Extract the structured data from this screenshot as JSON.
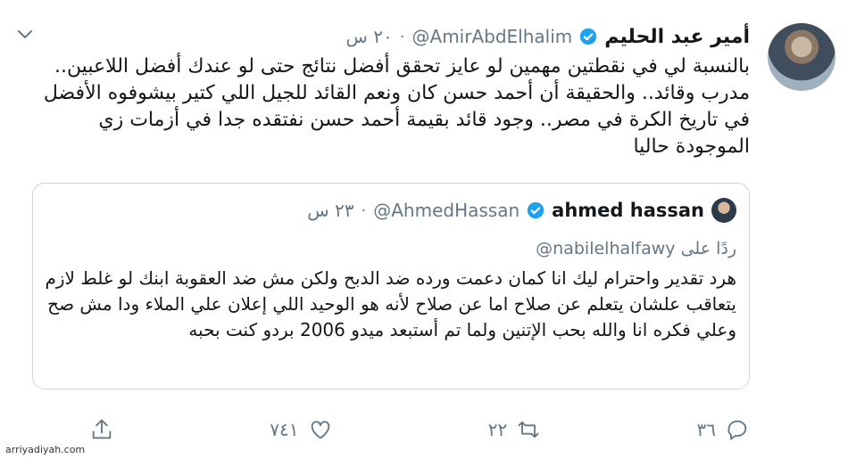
{
  "tweet": {
    "display_name": "أمير عبد الحليم",
    "handle": "@AmirAbdElhalim",
    "separator": "·",
    "time": "٢٠ س",
    "text": "بالنسبة لي في نقطتين مهمين لو عايز تحقق أفضل نتائج حتى لو عندك أفضل اللاعبين.. مدرب وقائد.. والحقيقة أن أحمد حسن كان ونعم القائد للجيل اللي كتير بيشوفوه الأفضل في تاريخ الكرة في مصر.. وجود قائد بقيمة أحمد حسن نفتقده جدا في أزمات زي الموجودة حاليا"
  },
  "quote": {
    "display_name": "ahmed hassan",
    "handle": "@AhmedHassan",
    "separator": "·",
    "time": "٢٣ س",
    "reply_prefix": "ردًا على",
    "reply_to": "@nabilelhalfawy",
    "text": "هرد تقدير واحترام ليك انا كمان دعمت ورده ضد الدبح ولكن مش ضد العقوبة ابنك لو غلط لازم يتعاقب علشان يتعلم عن صلاح اما عن صلاح لأنه هو الوحيد اللي إعلان علي الملاء ودا مش صح وعلي فكره انا والله بحب الإتنين ولما تم أستبعد ميدو 2006 بردو كنت بحبه"
  },
  "actions": {
    "reply_count": "٣٦",
    "retweet_count": "٢٢",
    "like_count": "٧٤١"
  },
  "icons": {
    "verified": "verified-badge-icon",
    "caret": "chevron-down-icon",
    "reply": "reply-icon",
    "retweet": "retweet-icon",
    "like": "heart-icon",
    "share": "share-icon"
  },
  "colors": {
    "text": "#14171a",
    "muted": "#657786",
    "verified": "#1da1f2",
    "border": "#ccd6dd"
  },
  "watermark": "arriyadiyah.com"
}
